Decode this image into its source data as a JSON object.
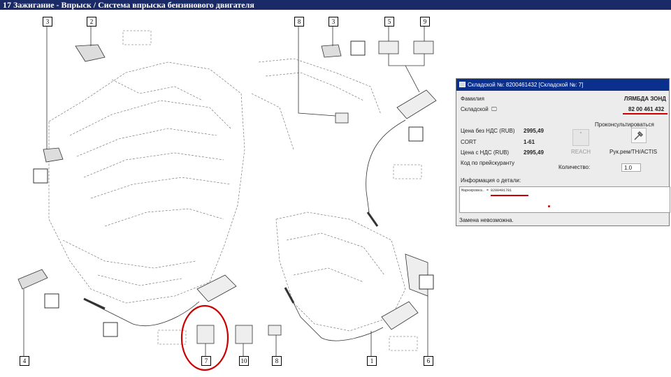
{
  "window": {
    "title": "17 Зажигание - Впрыск / Система впрыска бензинового двигателя"
  },
  "diagram": {
    "callouts": [
      "3",
      "2",
      "8",
      "3",
      "5",
      "9",
      "4",
      "7",
      "10",
      "8",
      "1",
      "6"
    ]
  },
  "part_panel": {
    "title": "Складской №: 8200461432 [Складской №: 7]",
    "family_label": "Фамилия",
    "family_value": "ЛЯМБДА ЗОНД",
    "stock_label": "Складской",
    "stock_value": "82 00 461 432",
    "price_no_vat_label": "Цена без НДС (RUB)",
    "price_no_vat_value": "2995,49",
    "cort_label": "CORT",
    "cort_value": "1-61",
    "price_vat_label": "Цена с НДС (RUB)",
    "price_vat_value": "2995,49",
    "pricelist_code_label": "Код по прейскуранту",
    "consult_label": "Проконсультироваться",
    "reach_label": "REACH",
    "manual_label": "Рук.рем/TH/ACTIS",
    "quantity_label": "Количество:",
    "quantity_value": "1.0",
    "info_label": "Информация о детали:",
    "info_text": "Маркировка. = 8200491781",
    "status": "Замена невозможна."
  },
  "colors": {
    "title_bar": "#1a2a66",
    "panel_header": "#0a2f8c",
    "highlight": "#cc0000"
  }
}
